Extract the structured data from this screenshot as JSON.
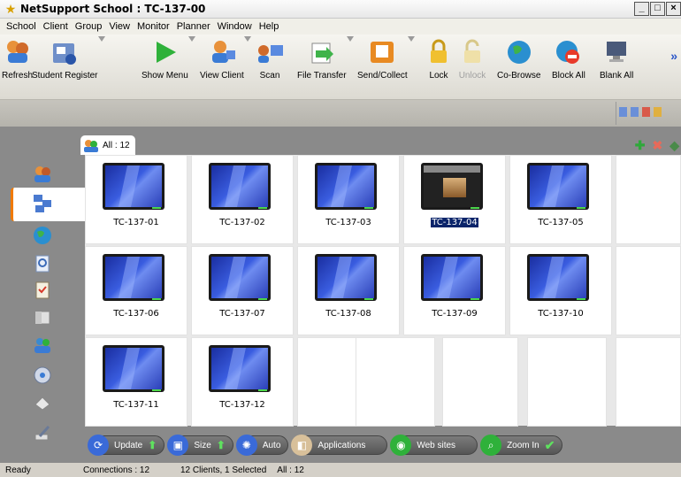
{
  "window": {
    "title": "NetSupport School : TC-137-00"
  },
  "menu": [
    "School",
    "Client",
    "Group",
    "View",
    "Monitor",
    "Planner",
    "Window",
    "Help"
  ],
  "toolbar": [
    {
      "label": "Refresh",
      "icon": "refresh-icon",
      "enabled": true
    },
    {
      "label": "Student Register",
      "icon": "student-register-icon",
      "enabled": true
    },
    {
      "label": "Show Menu",
      "icon": "show-menu-icon",
      "enabled": true
    },
    {
      "label": "View Client",
      "icon": "view-client-icon",
      "enabled": true
    },
    {
      "label": "Scan",
      "icon": "scan-icon",
      "enabled": true
    },
    {
      "label": "File Transfer",
      "icon": "file-transfer-icon",
      "enabled": true
    },
    {
      "label": "Send/Collect",
      "icon": "send-collect-icon",
      "enabled": true
    },
    {
      "label": "Lock",
      "icon": "lock-icon",
      "enabled": true
    },
    {
      "label": "Unlock",
      "icon": "unlock-icon",
      "enabled": false
    },
    {
      "label": "Co-Browse",
      "icon": "co-browse-icon",
      "enabled": true
    },
    {
      "label": "Block All",
      "icon": "block-all-icon",
      "enabled": true
    },
    {
      "label": "Blank All",
      "icon": "blank-all-icon",
      "enabled": true
    }
  ],
  "group_tab": {
    "label": "All : 12"
  },
  "clients": [
    {
      "name": "TC-137-01"
    },
    {
      "name": "TC-137-02"
    },
    {
      "name": "TC-137-03"
    },
    {
      "name": "TC-137-04",
      "selected": true
    },
    {
      "name": "TC-137-05"
    },
    {
      "name": "TC-137-06"
    },
    {
      "name": "TC-137-07"
    },
    {
      "name": "TC-137-08"
    },
    {
      "name": "TC-137-09"
    },
    {
      "name": "TC-137-10"
    },
    {
      "name": "TC-137-11"
    },
    {
      "name": "TC-137-12"
    }
  ],
  "bottom_bar": {
    "update": "Update",
    "size": "Size",
    "auto": "Auto",
    "applications": "Applications",
    "websites": "Web sites",
    "zoom_in": "Zoom In"
  },
  "status": {
    "ready": "Ready",
    "connections": "Connections : 12",
    "clients": "12 Clients, 1 Selected",
    "all": "All : 12"
  },
  "colors": {
    "accent": "#f07a00",
    "selection": "#0a246a",
    "led": "#4cd64c"
  }
}
